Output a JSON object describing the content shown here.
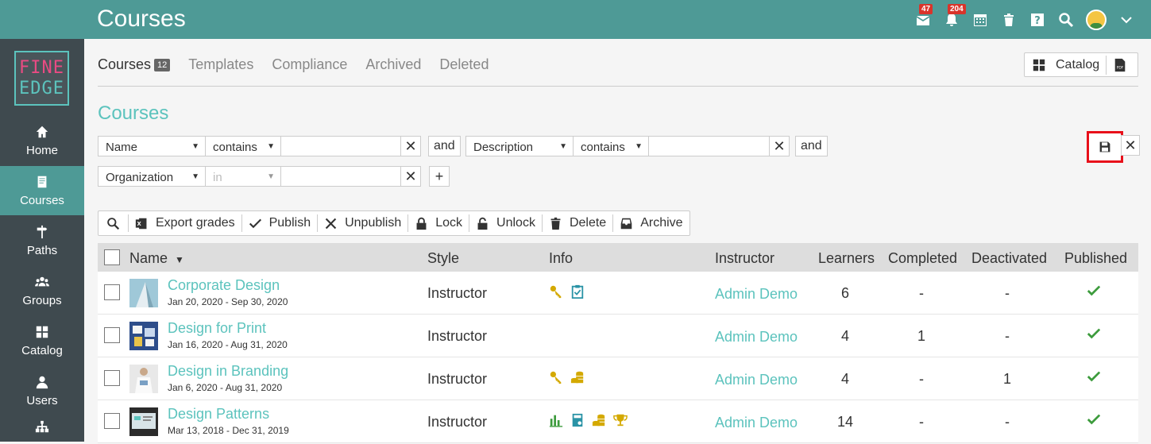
{
  "app": {
    "title": "Courses"
  },
  "top_icons": [
    {
      "icon": "envelope-icon",
      "badge": "47"
    },
    {
      "icon": "bell-icon",
      "badge": "204"
    },
    {
      "icon": "calendar-icon"
    },
    {
      "icon": "trash-icon"
    },
    {
      "icon": "help-icon"
    },
    {
      "icon": "search-icon"
    },
    {
      "icon": "avatar"
    },
    {
      "icon": "chevron-down-icon"
    }
  ],
  "sidebar": {
    "logo_top": "FINE",
    "logo_bottom": "EDGE",
    "items": [
      {
        "label": "Home",
        "icon": "home-icon"
      },
      {
        "label": "Courses",
        "icon": "book-icon",
        "active": true
      },
      {
        "label": "Paths",
        "icon": "signpost-icon"
      },
      {
        "label": "Groups",
        "icon": "group-icon"
      },
      {
        "label": "Catalog",
        "icon": "grid-icon"
      },
      {
        "label": "Users",
        "icon": "user-icon"
      }
    ]
  },
  "tabs": [
    {
      "label": "Courses",
      "count": "12"
    },
    {
      "label": "Templates"
    },
    {
      "label": "Compliance"
    },
    {
      "label": "Archived"
    },
    {
      "label": "Deleted"
    }
  ],
  "catalog_button": {
    "label": "Catalog"
  },
  "heading": "Courses",
  "filters": {
    "row1": {
      "field1": "Name",
      "op1": "contains",
      "and1": "and",
      "field2": "Description",
      "op2": "contains",
      "and2": "and"
    },
    "row2": {
      "field": "Organization",
      "op": "in"
    }
  },
  "toolbar": {
    "export": "Export grades",
    "publish": "Publish",
    "unpublish": "Unpublish",
    "lock": "Lock",
    "unlock": "Unlock",
    "delete": "Delete",
    "archive": "Archive"
  },
  "table": {
    "headers": {
      "name": "Name",
      "style": "Style",
      "info": "Info",
      "instructor": "Instructor",
      "learners": "Learners",
      "completed": "Completed",
      "deactivated": "Deactivated",
      "published": "Published"
    },
    "rows": [
      {
        "name": "Corporate Design",
        "dates": "Jan 20, 2020 - Sep 30, 2020",
        "style": "Instructor",
        "instructor": "Admin Demo",
        "learners": "6",
        "completed": "-",
        "deactivated": "-"
      },
      {
        "name": "Design for Print",
        "dates": "Jan 16, 2020 - Aug 31, 2020",
        "style": "Instructor",
        "instructor": "Admin Demo",
        "learners": "4",
        "completed": "1",
        "deactivated": "-"
      },
      {
        "name": "Design in Branding",
        "dates": "Jan 6, 2020 - Aug 31, 2020",
        "style": "Instructor",
        "instructor": "Admin Demo",
        "learners": "4",
        "completed": "-",
        "deactivated": "1"
      },
      {
        "name": "Design Patterns",
        "dates": "Mar 13, 2018 - Dec 31, 2019",
        "style": "Instructor",
        "instructor": "Admin Demo",
        "learners": "14",
        "completed": "-",
        "deactivated": "-"
      }
    ]
  },
  "colors": {
    "topbar": "#4e9a96",
    "sidebar": "#3f4a4f",
    "accent": "#5cc3bd",
    "gold": "#d4a900",
    "check": "#3c9b3c",
    "highlight": "#e8101a"
  }
}
